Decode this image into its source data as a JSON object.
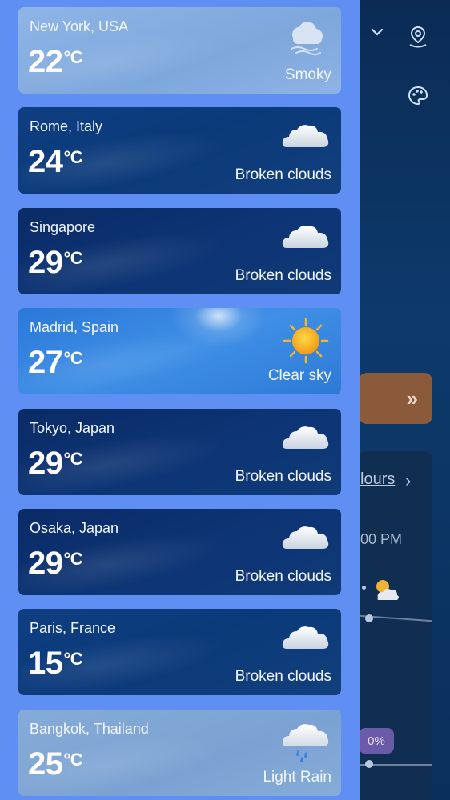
{
  "background_app": {
    "hours_link": "lours",
    "time_label": "00 PM",
    "precip_pct": "0%"
  },
  "cities": [
    {
      "name": "New York, USA",
      "temp": "22",
      "unit": "°C",
      "condition": "Smoky",
      "icon": "smoke-icon",
      "theme": "smoky"
    },
    {
      "name": "Rome, Italy",
      "temp": "24",
      "unit": "°C",
      "condition": "Broken clouds",
      "icon": "cloud-icon",
      "theme": "clouds"
    },
    {
      "name": "Singapore",
      "temp": "29",
      "unit": "°C",
      "condition": "Broken clouds",
      "icon": "cloud-icon",
      "theme": "clouds-dark"
    },
    {
      "name": "Madrid, Spain",
      "temp": "27",
      "unit": "°C",
      "condition": "Clear sky",
      "icon": "sun-icon",
      "theme": "clear"
    },
    {
      "name": "Tokyo, Japan",
      "temp": "29",
      "unit": "°C",
      "condition": "Broken clouds",
      "icon": "cloud-icon",
      "theme": "clouds-dark"
    },
    {
      "name": "Osaka, Japan",
      "temp": "29",
      "unit": "°C",
      "condition": "Broken clouds",
      "icon": "cloud-icon",
      "theme": "clouds-dark"
    },
    {
      "name": "Paris, France",
      "temp": "15",
      "unit": "°C",
      "condition": "Broken clouds",
      "icon": "cloud-icon",
      "theme": "clouds"
    },
    {
      "name": "Bangkok, Thailand",
      "temp": "25",
      "unit": "°C",
      "condition": "Light Rain",
      "icon": "rain-cloud-icon",
      "theme": "rain"
    }
  ],
  "colors": {
    "drawer": "#5f8ff2",
    "background": "#0a2f5c"
  }
}
